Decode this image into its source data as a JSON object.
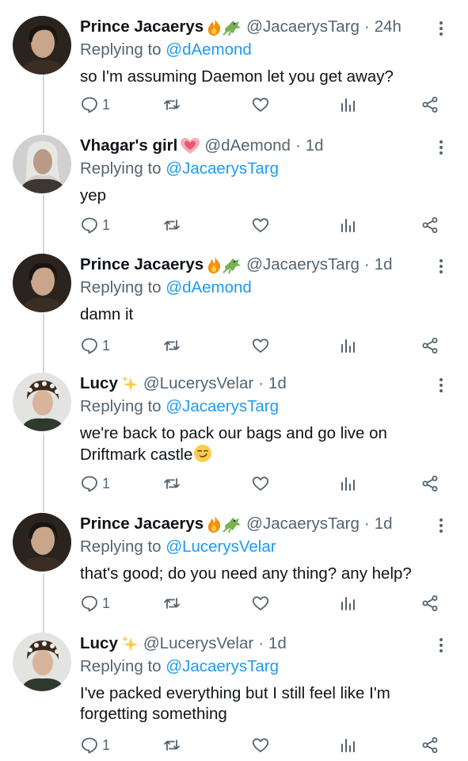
{
  "tweets": [
    {
      "name": "Prince Jacaerys",
      "badge": "fire-dragon",
      "handle": "@JacaerysTarg",
      "time": "24h",
      "reply_prefix": "Replying to",
      "reply_to": "@dAemond",
      "text": "so I'm assuming Daemon let you get away?",
      "reply_count": "1"
    },
    {
      "name": "Vhagar's girl",
      "badge": "heart",
      "handle": "@dAemond",
      "time": "1d",
      "reply_prefix": "Replying to",
      "reply_to": "@JacaerysTarg",
      "text": "yep",
      "reply_count": "1"
    },
    {
      "name": "Prince Jacaerys",
      "badge": "fire-dragon",
      "handle": "@JacaerysTarg",
      "time": "1d",
      "reply_prefix": "Replying to",
      "reply_to": "@dAemond",
      "text": "damn it",
      "reply_count": "1"
    },
    {
      "name": "Lucy",
      "badge": "sparkles",
      "handle": "@LucerysVelar",
      "time": "1d",
      "reply_prefix": "Replying to",
      "reply_to": "@JacaerysTarg",
      "text_line1": "we're back to pack our bags and go live on",
      "text_line2": "Driftmark castle",
      "reply_count": "1"
    },
    {
      "name": "Prince Jacaerys",
      "badge": "fire-dragon",
      "handle": "@JacaerysTarg",
      "time": "1d",
      "reply_prefix": "Replying to",
      "reply_to": "@LucerysVelar",
      "text": "that's good; do you need any thing? any help?",
      "reply_count": "1"
    },
    {
      "name": "Lucy",
      "badge": "sparkles",
      "handle": "@LucerysVelar",
      "time": "1d",
      "reply_prefix": "Replying to",
      "reply_to": "@JacaerysTarg",
      "text_line1": "I've packed everything but I still feel like I'm",
      "text_line2": "forgetting something",
      "reply_count": "1"
    }
  ],
  "colors": {
    "text": "#0f1419",
    "secondary": "#536471",
    "link": "#1d9bf0",
    "thread_line": "#cfd9de"
  }
}
